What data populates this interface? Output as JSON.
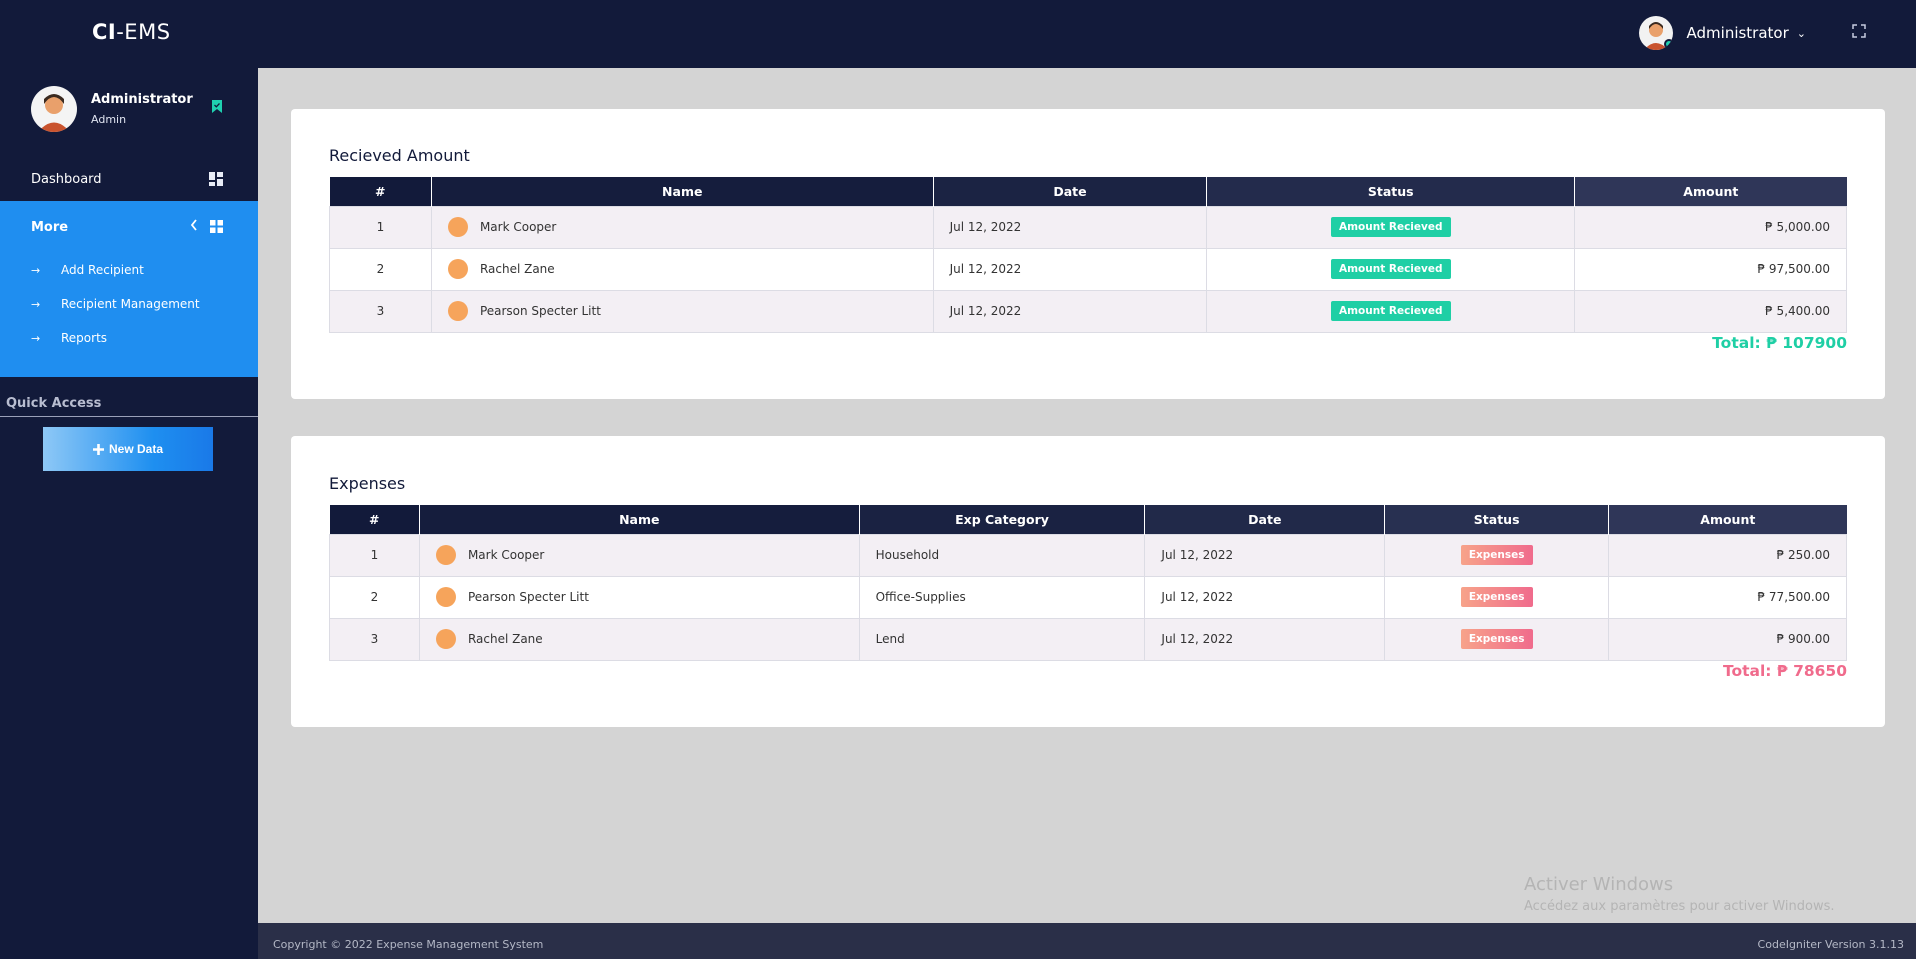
{
  "app": {
    "brand_bold": "CI",
    "brand_rest": "-EMS"
  },
  "topbar": {
    "user_name": "Administrator",
    "caret": "⌄"
  },
  "sidebar": {
    "profile_name": "Administrator",
    "profile_role": "Admin",
    "dashboard_label": "Dashboard",
    "more_label": "More",
    "items": [
      {
        "label": "Add Recipient"
      },
      {
        "label": "Recipient Management"
      },
      {
        "label": "Reports"
      }
    ],
    "quick_access_label": "Quick Access",
    "new_data_label": "New Data"
  },
  "received": {
    "title": "Recieved Amount",
    "columns": [
      "#",
      "Name",
      "Date",
      "Status",
      "Amount"
    ],
    "rows": [
      {
        "num": "1",
        "name": "Mark Cooper",
        "date": "Jul 12, 2022",
        "status": "Amount Recieved",
        "amount": "₱ 5,000.00"
      },
      {
        "num": "2",
        "name": "Rachel Zane",
        "date": "Jul 12, 2022",
        "status": "Amount Recieved",
        "amount": "₱ 97,500.00"
      },
      {
        "num": "3",
        "name": "Pearson Specter Litt",
        "date": "Jul 12, 2022",
        "status": "Amount Recieved",
        "amount": "₱ 5,400.00"
      }
    ],
    "total": "Total: ₱ 107900"
  },
  "expenses": {
    "title": "Expenses",
    "columns": [
      "#",
      "Name",
      "Exp Category",
      "Date",
      "Status",
      "Amount"
    ],
    "rows": [
      {
        "num": "1",
        "name": "Mark Cooper",
        "category": "Household",
        "date": "Jul 12, 2022",
        "status": "Expenses",
        "amount": "₱ 250.00"
      },
      {
        "num": "2",
        "name": "Pearson Specter Litt",
        "category": "Office-Supplies",
        "date": "Jul 12, 2022",
        "status": "Expenses",
        "amount": "₱ 77,500.00"
      },
      {
        "num": "3",
        "name": "Rachel Zane",
        "category": "Lend",
        "date": "Jul 12, 2022",
        "status": "Expenses",
        "amount": "₱ 900.00"
      }
    ],
    "total": "Total: ₱ 78650"
  },
  "watermark": {
    "line1": "Activer Windows",
    "line2": "Accédez aux paramètres pour activer Windows."
  },
  "footer": {
    "copyright": "Copyright © 2022 Expense Management System",
    "version": "CodeIgniter Version 3.1.13"
  },
  "colors": {
    "navy": "#121a3a",
    "accent_blue": "#1f8ef0",
    "green": "#1fcfa5",
    "pink": "#f06b8c"
  }
}
